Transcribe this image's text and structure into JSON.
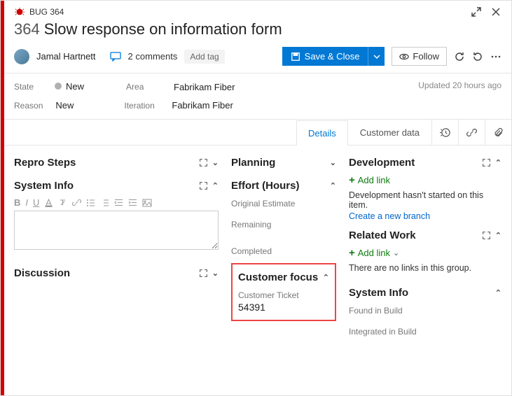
{
  "header": {
    "type_label": "BUG 364",
    "id": "364",
    "title": "Slow response on information form"
  },
  "toolbar": {
    "assignee": "Jamal Hartnett",
    "comments": "2 comments",
    "add_tag": "Add tag",
    "save": "Save & Close",
    "follow": "Follow"
  },
  "fields": {
    "state_label": "State",
    "state_value": "New",
    "reason_label": "Reason",
    "reason_value": "New",
    "area_label": "Area",
    "area_value": "Fabrikam Fiber",
    "iteration_label": "Iteration",
    "iteration_value": "Fabrikam Fiber",
    "updated": "Updated 20 hours ago"
  },
  "tabs": {
    "details": "Details",
    "customer_data": "Customer data"
  },
  "col1": {
    "repro": "Repro Steps",
    "sysinfo": "System Info",
    "discussion": "Discussion"
  },
  "col2": {
    "planning": "Planning",
    "effort": "Effort (Hours)",
    "original": "Original Estimate",
    "remaining": "Remaining",
    "completed": "Completed",
    "customer_focus": "Customer focus",
    "ticket_label": "Customer Ticket",
    "ticket_value": "54391"
  },
  "col3": {
    "development": "Development",
    "add_link": "Add link",
    "dev_msg": "Development hasn't started on this item.",
    "create_branch": "Create a new branch",
    "related": "Related Work",
    "add_link2": "Add link",
    "no_links": "There are no links in this group.",
    "sysinfo": "System Info",
    "found": "Found in Build",
    "integrated": "Integrated in Build"
  }
}
